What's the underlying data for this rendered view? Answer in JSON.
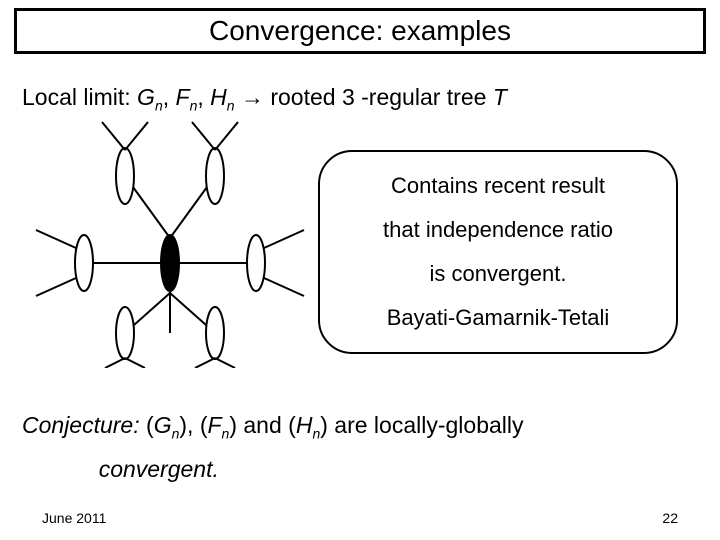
{
  "title": "Convergence: examples",
  "local_limit": {
    "prefix": "Local limit:",
    "G": "G",
    "F": "F",
    "H": "H",
    "sub": "n",
    "arrow": "→",
    "suffix_a": " rooted 3 -regular tree",
    "suffix_b": " T"
  },
  "callout": {
    "l1": "Contains recent result",
    "l2": "that independence ratio",
    "l3": "is convergent.",
    "l4": "Bayati-Gamarnik-Tetali"
  },
  "conjecture": {
    "label": "Conjecture:",
    "g": "G",
    "f": "F",
    "h": "H",
    "sub": "n",
    "mid1": " (",
    "mid2": "), (",
    "mid3": ") and (",
    "mid4": ") are locally-globally",
    "line2": "convergent."
  },
  "footer": {
    "date": "June 2011",
    "page": "22"
  }
}
